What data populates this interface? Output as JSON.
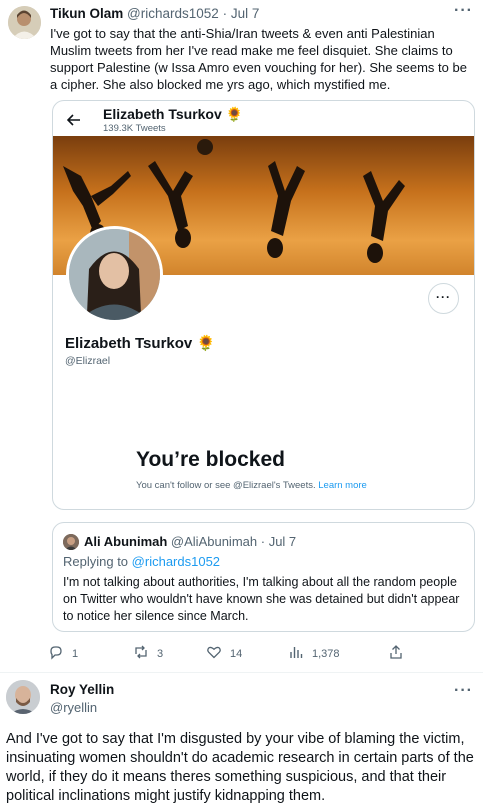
{
  "tweet": {
    "author_name": "Tikun Olam",
    "author_handle": "@richards1052",
    "separator": "·",
    "date": "Jul 7",
    "more_label": "···",
    "text": "I've got to say that the anti-Shia/Iran tweets & even anti Palestinian Muslim tweets from her I've read make me feel disquiet. She claims to support Palestine (w Issa Amro even vouching for her). She seems to be a cipher. She also blocked me yrs ago, which mystified me.",
    "stats": {
      "replies": "1",
      "retweets": "3",
      "likes": "14",
      "views": "1,378"
    }
  },
  "embedded_profile": {
    "back_icon": "arrow-left-icon",
    "name": "Elizabeth Tsurkov",
    "name_emoji": "🌻",
    "tweet_count": "139.3K Tweets",
    "handle": "@Elizrael",
    "more_label": "···",
    "blocked_title": "You’re blocked",
    "blocked_desc": "You can't follow or see @Elizrael's Tweets.",
    "learn_more": "Learn more"
  },
  "quoted_tweet": {
    "author_name": "Ali Abunimah",
    "author_handle": "@AliAbunimah",
    "separator": "·",
    "date": "Jul 7",
    "replying_prefix": "Replying to",
    "replying_to": "@richards1052",
    "text": "I'm not talking about authorities, I'm talking about all the random people on Twitter who wouldn't have known she was detained but didn't appear to notice her silence since March."
  },
  "reply": {
    "author_name": "Roy Yellin",
    "author_handle": "@ryellin",
    "more_label": "···",
    "text": "And I've got to say that I'm  disgusted by your  vibe of blaming the victim, insinuating  women shouldn't do academic research in certain parts of the world,  if they do it means  theres something suspicious, and  that their political inclinations might justify kidnapping them."
  },
  "colors": {
    "link": "#1d9bf0",
    "secondary_text": "#536471",
    "border": "#cfd9de"
  }
}
